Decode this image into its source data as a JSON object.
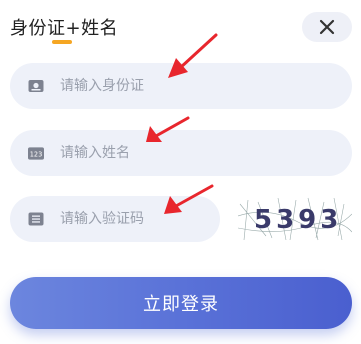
{
  "header": {
    "title": "身份证+姓名"
  },
  "icons": {
    "close": "close-icon",
    "id_card": "id-card-icon",
    "number_badge": "number-badge-icon",
    "list": "list-icon"
  },
  "fields": {
    "id_card": {
      "placeholder": "请输入身份证",
      "value": ""
    },
    "name": {
      "placeholder": "请输入姓名",
      "value": "",
      "icon_text": "123"
    },
    "captcha": {
      "placeholder": "请输入验证码",
      "value": ""
    }
  },
  "captcha_image": {
    "text": "5393"
  },
  "submit": {
    "label": "立即登录"
  },
  "colors": {
    "accent": "#f5a623",
    "annotation_arrow": "#e8262d",
    "button_start": "#6c86de",
    "button_end": "#4a5fcf",
    "field_bg": "#eef1f9"
  }
}
